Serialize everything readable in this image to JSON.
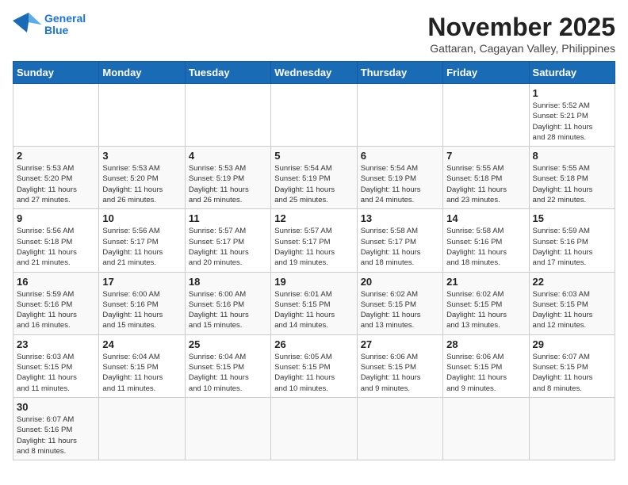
{
  "header": {
    "logo_line1": "General",
    "logo_line2": "Blue",
    "month": "November 2025",
    "location": "Gattaran, Cagayan Valley, Philippines"
  },
  "weekdays": [
    "Sunday",
    "Monday",
    "Tuesday",
    "Wednesday",
    "Thursday",
    "Friday",
    "Saturday"
  ],
  "weeks": [
    [
      {
        "day": "",
        "info": ""
      },
      {
        "day": "",
        "info": ""
      },
      {
        "day": "",
        "info": ""
      },
      {
        "day": "",
        "info": ""
      },
      {
        "day": "",
        "info": ""
      },
      {
        "day": "",
        "info": ""
      },
      {
        "day": "1",
        "info": "Sunrise: 5:52 AM\nSunset: 5:21 PM\nDaylight: 11 hours\nand 28 minutes."
      }
    ],
    [
      {
        "day": "2",
        "info": "Sunrise: 5:53 AM\nSunset: 5:20 PM\nDaylight: 11 hours\nand 27 minutes."
      },
      {
        "day": "3",
        "info": "Sunrise: 5:53 AM\nSunset: 5:20 PM\nDaylight: 11 hours\nand 26 minutes."
      },
      {
        "day": "4",
        "info": "Sunrise: 5:53 AM\nSunset: 5:19 PM\nDaylight: 11 hours\nand 26 minutes."
      },
      {
        "day": "5",
        "info": "Sunrise: 5:54 AM\nSunset: 5:19 PM\nDaylight: 11 hours\nand 25 minutes."
      },
      {
        "day": "6",
        "info": "Sunrise: 5:54 AM\nSunset: 5:19 PM\nDaylight: 11 hours\nand 24 minutes."
      },
      {
        "day": "7",
        "info": "Sunrise: 5:55 AM\nSunset: 5:18 PM\nDaylight: 11 hours\nand 23 minutes."
      },
      {
        "day": "8",
        "info": "Sunrise: 5:55 AM\nSunset: 5:18 PM\nDaylight: 11 hours\nand 22 minutes."
      }
    ],
    [
      {
        "day": "9",
        "info": "Sunrise: 5:56 AM\nSunset: 5:18 PM\nDaylight: 11 hours\nand 21 minutes."
      },
      {
        "day": "10",
        "info": "Sunrise: 5:56 AM\nSunset: 5:17 PM\nDaylight: 11 hours\nand 21 minutes."
      },
      {
        "day": "11",
        "info": "Sunrise: 5:57 AM\nSunset: 5:17 PM\nDaylight: 11 hours\nand 20 minutes."
      },
      {
        "day": "12",
        "info": "Sunrise: 5:57 AM\nSunset: 5:17 PM\nDaylight: 11 hours\nand 19 minutes."
      },
      {
        "day": "13",
        "info": "Sunrise: 5:58 AM\nSunset: 5:17 PM\nDaylight: 11 hours\nand 18 minutes."
      },
      {
        "day": "14",
        "info": "Sunrise: 5:58 AM\nSunset: 5:16 PM\nDaylight: 11 hours\nand 18 minutes."
      },
      {
        "day": "15",
        "info": "Sunrise: 5:59 AM\nSunset: 5:16 PM\nDaylight: 11 hours\nand 17 minutes."
      }
    ],
    [
      {
        "day": "16",
        "info": "Sunrise: 5:59 AM\nSunset: 5:16 PM\nDaylight: 11 hours\nand 16 minutes."
      },
      {
        "day": "17",
        "info": "Sunrise: 6:00 AM\nSunset: 5:16 PM\nDaylight: 11 hours\nand 15 minutes."
      },
      {
        "day": "18",
        "info": "Sunrise: 6:00 AM\nSunset: 5:16 PM\nDaylight: 11 hours\nand 15 minutes."
      },
      {
        "day": "19",
        "info": "Sunrise: 6:01 AM\nSunset: 5:15 PM\nDaylight: 11 hours\nand 14 minutes."
      },
      {
        "day": "20",
        "info": "Sunrise: 6:02 AM\nSunset: 5:15 PM\nDaylight: 11 hours\nand 13 minutes."
      },
      {
        "day": "21",
        "info": "Sunrise: 6:02 AM\nSunset: 5:15 PM\nDaylight: 11 hours\nand 13 minutes."
      },
      {
        "day": "22",
        "info": "Sunrise: 6:03 AM\nSunset: 5:15 PM\nDaylight: 11 hours\nand 12 minutes."
      }
    ],
    [
      {
        "day": "23",
        "info": "Sunrise: 6:03 AM\nSunset: 5:15 PM\nDaylight: 11 hours\nand 11 minutes."
      },
      {
        "day": "24",
        "info": "Sunrise: 6:04 AM\nSunset: 5:15 PM\nDaylight: 11 hours\nand 11 minutes."
      },
      {
        "day": "25",
        "info": "Sunrise: 6:04 AM\nSunset: 5:15 PM\nDaylight: 11 hours\nand 10 minutes."
      },
      {
        "day": "26",
        "info": "Sunrise: 6:05 AM\nSunset: 5:15 PM\nDaylight: 11 hours\nand 10 minutes."
      },
      {
        "day": "27",
        "info": "Sunrise: 6:06 AM\nSunset: 5:15 PM\nDaylight: 11 hours\nand 9 minutes."
      },
      {
        "day": "28",
        "info": "Sunrise: 6:06 AM\nSunset: 5:15 PM\nDaylight: 11 hours\nand 9 minutes."
      },
      {
        "day": "29",
        "info": "Sunrise: 6:07 AM\nSunset: 5:15 PM\nDaylight: 11 hours\nand 8 minutes."
      }
    ],
    [
      {
        "day": "30",
        "info": "Sunrise: 6:07 AM\nSunset: 5:16 PM\nDaylight: 11 hours\nand 8 minutes."
      },
      {
        "day": "",
        "info": ""
      },
      {
        "day": "",
        "info": ""
      },
      {
        "day": "",
        "info": ""
      },
      {
        "day": "",
        "info": ""
      },
      {
        "day": "",
        "info": ""
      },
      {
        "day": "",
        "info": ""
      }
    ]
  ]
}
